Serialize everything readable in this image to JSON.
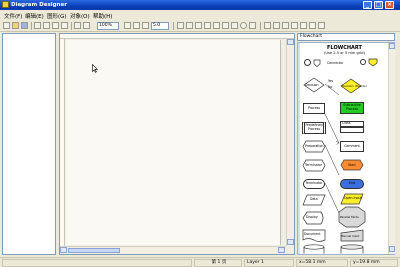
{
  "window": {
    "title": "Diagram Designer",
    "minimize_label": "_",
    "maximize_label": "□",
    "close_label": "×"
  },
  "menu": [
    "文件(F)",
    "编辑(E)",
    "图形(G)",
    "对象(O)",
    "帮助(H)"
  ],
  "toolbar": {
    "zoom_value": "100%",
    "grid_value": "5.0"
  },
  "stencil": {
    "selected": "Flowchart",
    "title": "FLOWCHART",
    "subtitle": "(Use 2.5 or 5 mm grid)",
    "labels": {
      "connector": "Connector",
      "decision": "Decision",
      "yes": "Yes",
      "no": "No",
      "decision2": "Decision (Decide)",
      "process": "Process",
      "subroutine": "Subroutine Process",
      "predef": "Predefined Process",
      "class": "Class",
      "preparation": "Preparation",
      "comment": "Comment",
      "terminator1": "Terminator",
      "start": "Start",
      "terminator2": "Terminator",
      "end": "End",
      "data": "Data",
      "open_input": "Open Input",
      "display": "Display",
      "document": "Document",
      "manual_input": "Manual Input",
      "parallel": "Parallel Mode",
      "manual_op": "Manual Operation",
      "magnetic": "Magnetic Disk"
    }
  },
  "status": {
    "page": "第 1 页",
    "layer": "Layer 1",
    "x": "x=58.1 mm",
    "y": "y=19.8 mm"
  },
  "colors": {
    "title_bar": "#0a3fb8",
    "green": "#22cc22",
    "orange": "#ff8c32",
    "blue": "#3b6fe0",
    "yellow": "#ffef2a"
  }
}
